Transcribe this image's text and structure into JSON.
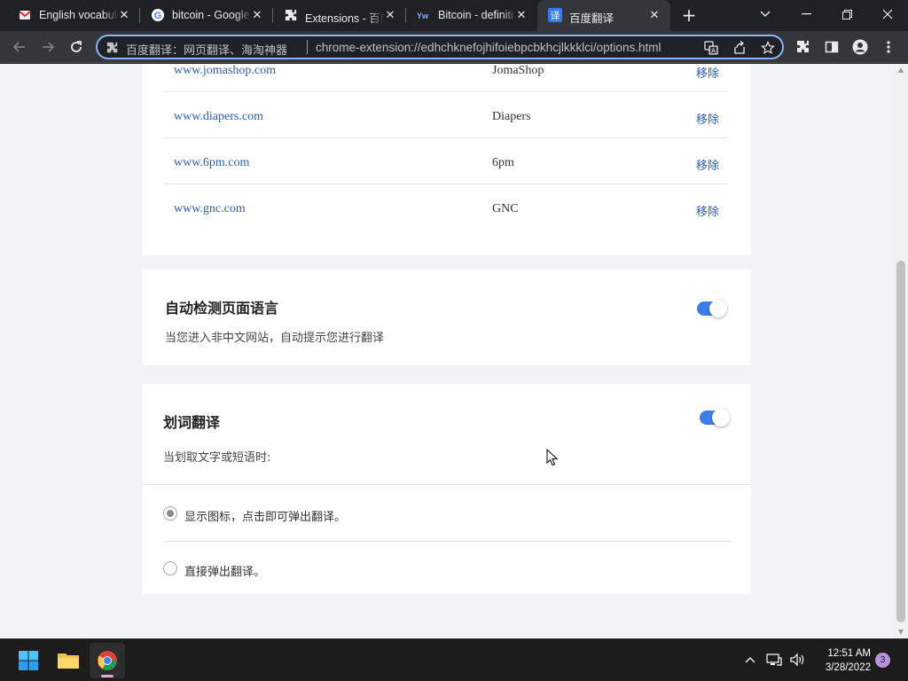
{
  "browser": {
    "tabs": [
      {
        "title": "English vocabula",
        "icon": "gmail-sheets-icon"
      },
      {
        "title": "bitcoin - Google",
        "icon": "google-icon"
      },
      {
        "title": "Extensions - 百度",
        "icon": "puzzle-icon"
      },
      {
        "title": "Bitcoin - definiti",
        "icon": "dictionary-icon"
      },
      {
        "title": "百度翻译",
        "icon": "baidu-translate-icon"
      }
    ],
    "active_tab_index": 4,
    "omnibox": {
      "origin": "百度翻译：网页翻译、海淘神器",
      "url": "chrome-extension://edhchknefojhifoiebpcbkhcjlkkklci/options.html"
    }
  },
  "sites": [
    {
      "domain": "www.jomashop.com",
      "name": "JomaShop",
      "action": "移除"
    },
    {
      "domain": "www.diapers.com",
      "name": "Diapers",
      "action": "移除"
    },
    {
      "domain": "www.6pm.com",
      "name": "6pm",
      "action": "移除"
    },
    {
      "domain": "www.gnc.com",
      "name": "GNC",
      "action": "移除"
    }
  ],
  "auto_detect": {
    "title": "自动检测页面语言",
    "desc": "当您进入非中文网站，自动提示您进行翻译",
    "enabled": true
  },
  "word_translate": {
    "title": "划词翻译",
    "desc": "当划取文字或短语时:",
    "enabled": true,
    "options": [
      {
        "label": "显示图标，点击即可弹出翻译。",
        "checked": true
      },
      {
        "label": "直接弹出翻译。",
        "checked": false
      }
    ]
  },
  "taskbar": {
    "time": "12:51 AM",
    "date": "3/28/2022",
    "notifications": "3"
  },
  "colors": {
    "accent": "#3b7fe6",
    "link": "#2a5db8",
    "omnibox_border": "#8ab4f8"
  }
}
